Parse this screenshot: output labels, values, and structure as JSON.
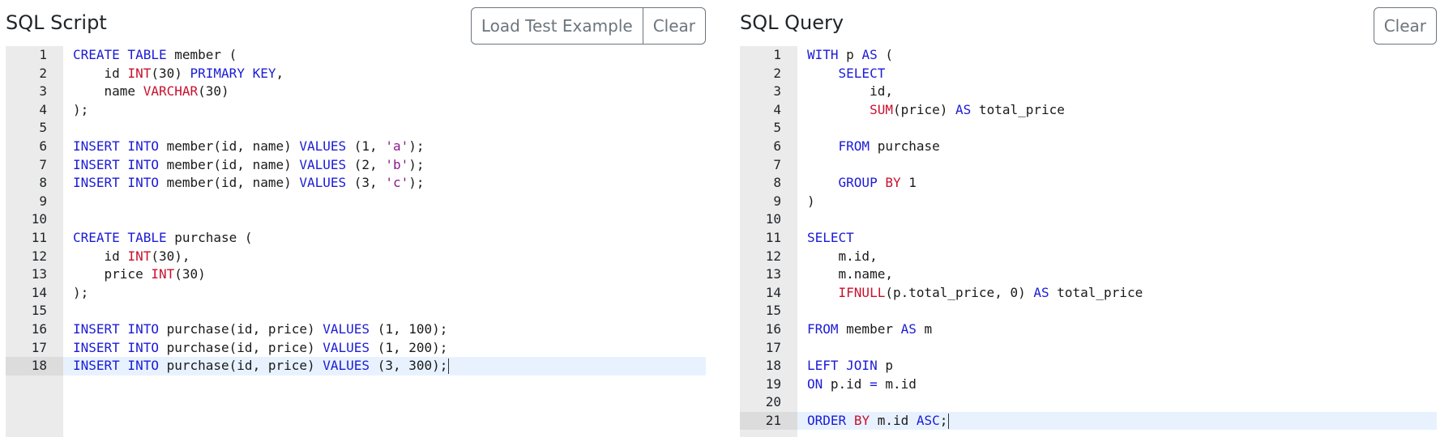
{
  "colors": {
    "keyword": "#1b1bd6",
    "type": "#c8102e",
    "function": "#c8102e",
    "string": "#8a1a8a",
    "gutter": "#ebebeb",
    "active_line": "#e8f2ff",
    "button_border": "#6c757d"
  },
  "script_panel": {
    "title": "SQL Script",
    "load_button": "Load Test Example",
    "clear_button": "Clear",
    "active_line": 18,
    "lines": [
      [
        {
          "t": "CREATE TABLE",
          "c": "kw"
        },
        {
          "t": " member (",
          "c": ""
        }
      ],
      [
        {
          "t": "    id ",
          "c": ""
        },
        {
          "t": "INT",
          "c": "ty"
        },
        {
          "t": "(30) ",
          "c": ""
        },
        {
          "t": "PRIMARY KEY",
          "c": "kw"
        },
        {
          "t": ",",
          "c": ""
        }
      ],
      [
        {
          "t": "    name ",
          "c": ""
        },
        {
          "t": "VARCHAR",
          "c": "ty"
        },
        {
          "t": "(30)",
          "c": ""
        }
      ],
      [
        {
          "t": ");",
          "c": ""
        }
      ],
      [],
      [
        {
          "t": "INSERT INTO",
          "c": "kw"
        },
        {
          "t": " member(id, name) ",
          "c": ""
        },
        {
          "t": "VALUES",
          "c": "kw"
        },
        {
          "t": " (1, ",
          "c": ""
        },
        {
          "t": "'a'",
          "c": "str"
        },
        {
          "t": ");",
          "c": ""
        }
      ],
      [
        {
          "t": "INSERT INTO",
          "c": "kw"
        },
        {
          "t": " member(id, name) ",
          "c": ""
        },
        {
          "t": "VALUES",
          "c": "kw"
        },
        {
          "t": " (2, ",
          "c": ""
        },
        {
          "t": "'b'",
          "c": "str"
        },
        {
          "t": ");",
          "c": ""
        }
      ],
      [
        {
          "t": "INSERT INTO",
          "c": "kw"
        },
        {
          "t": " member(id, name) ",
          "c": ""
        },
        {
          "t": "VALUES",
          "c": "kw"
        },
        {
          "t": " (3, ",
          "c": ""
        },
        {
          "t": "'c'",
          "c": "str"
        },
        {
          "t": ");",
          "c": ""
        }
      ],
      [],
      [],
      [
        {
          "t": "CREATE TABLE",
          "c": "kw"
        },
        {
          "t": " purchase (",
          "c": ""
        }
      ],
      [
        {
          "t": "    id ",
          "c": ""
        },
        {
          "t": "INT",
          "c": "ty"
        },
        {
          "t": "(30),",
          "c": ""
        }
      ],
      [
        {
          "t": "    price ",
          "c": ""
        },
        {
          "t": "INT",
          "c": "ty"
        },
        {
          "t": "(30)",
          "c": ""
        }
      ],
      [
        {
          "t": ");",
          "c": ""
        }
      ],
      [],
      [
        {
          "t": "INSERT INTO",
          "c": "kw"
        },
        {
          "t": " purchase(id, price) ",
          "c": ""
        },
        {
          "t": "VALUES",
          "c": "kw"
        },
        {
          "t": " (1, 100);",
          "c": ""
        }
      ],
      [
        {
          "t": "INSERT INTO",
          "c": "kw"
        },
        {
          "t": " purchase(id, price) ",
          "c": ""
        },
        {
          "t": "VALUES",
          "c": "kw"
        },
        {
          "t": " (1, 200);",
          "c": ""
        }
      ],
      [
        {
          "t": "INSERT INTO",
          "c": "kw"
        },
        {
          "t": " purchase(id, price) ",
          "c": ""
        },
        {
          "t": "VALUES",
          "c": "kw"
        },
        {
          "t": " (3, 300);",
          "c": ""
        }
      ]
    ]
  },
  "query_panel": {
    "title": "SQL Query",
    "clear_button": "Clear",
    "active_line": 21,
    "lines": [
      [
        {
          "t": "WITH",
          "c": "kw"
        },
        {
          "t": " p ",
          "c": ""
        },
        {
          "t": "AS",
          "c": "kw"
        },
        {
          "t": " (",
          "c": ""
        }
      ],
      [
        {
          "t": "    ",
          "c": ""
        },
        {
          "t": "SELECT",
          "c": "kw"
        }
      ],
      [
        {
          "t": "        id,",
          "c": ""
        }
      ],
      [
        {
          "t": "        ",
          "c": ""
        },
        {
          "t": "SUM",
          "c": "fn"
        },
        {
          "t": "(price) ",
          "c": ""
        },
        {
          "t": "AS",
          "c": "kw"
        },
        {
          "t": " total_price",
          "c": ""
        }
      ],
      [],
      [
        {
          "t": "    ",
          "c": ""
        },
        {
          "t": "FROM",
          "c": "kw"
        },
        {
          "t": " purchase",
          "c": ""
        }
      ],
      [],
      [
        {
          "t": "    ",
          "c": ""
        },
        {
          "t": "GROUP",
          "c": "kw"
        },
        {
          "t": " ",
          "c": ""
        },
        {
          "t": "BY",
          "c": "ty"
        },
        {
          "t": " 1",
          "c": ""
        }
      ],
      [
        {
          "t": ")",
          "c": ""
        }
      ],
      [],
      [
        {
          "t": "SELECT",
          "c": "kw"
        }
      ],
      [
        {
          "t": "    m.id,",
          "c": ""
        }
      ],
      [
        {
          "t": "    m.name,",
          "c": ""
        }
      ],
      [
        {
          "t": "    ",
          "c": ""
        },
        {
          "t": "IFNULL",
          "c": "fn"
        },
        {
          "t": "(p.total_price, 0) ",
          "c": ""
        },
        {
          "t": "AS",
          "c": "kw"
        },
        {
          "t": " total_price",
          "c": ""
        }
      ],
      [],
      [
        {
          "t": "FROM",
          "c": "kw"
        },
        {
          "t": " member ",
          "c": ""
        },
        {
          "t": "AS",
          "c": "kw"
        },
        {
          "t": " m",
          "c": ""
        }
      ],
      [],
      [
        {
          "t": "LEFT JOIN",
          "c": "kw"
        },
        {
          "t": " p",
          "c": ""
        }
      ],
      [
        {
          "t": "ON",
          "c": "kw"
        },
        {
          "t": " p.id ",
          "c": ""
        },
        {
          "t": "=",
          "c": "kw"
        },
        {
          "t": " m.id",
          "c": ""
        }
      ],
      [],
      [
        {
          "t": "ORDER",
          "c": "kw"
        },
        {
          "t": " ",
          "c": ""
        },
        {
          "t": "BY",
          "c": "ty"
        },
        {
          "t": " m.id ",
          "c": ""
        },
        {
          "t": "ASC",
          "c": "kw"
        },
        {
          "t": ";",
          "c": ""
        }
      ]
    ]
  }
}
